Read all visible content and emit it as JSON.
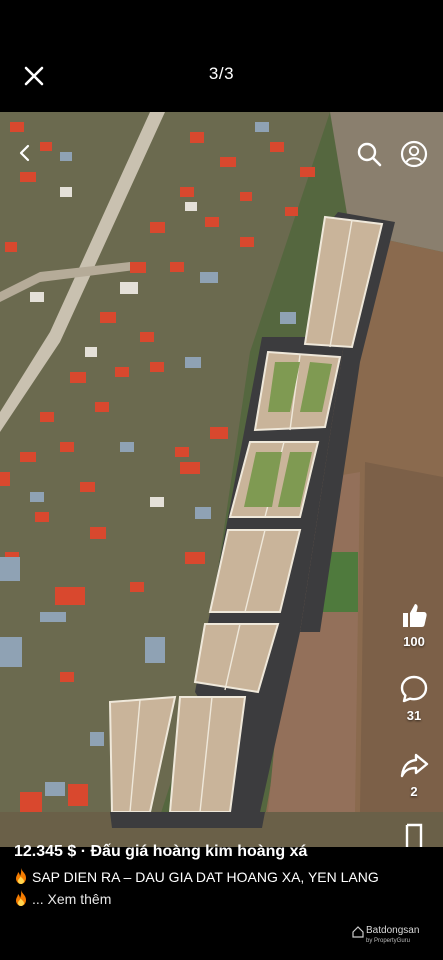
{
  "header": {
    "counter": "3/3"
  },
  "actions": {
    "like_count": "100",
    "comment_count": "31",
    "share_count": "2"
  },
  "post": {
    "title": "12.345 $ · Đấu giá hoàng kim hoàng xá",
    "line2": "SAP DIEN RA – DAU GIA DAT HOANG XA, YEN LANG",
    "line3": "... Xem thêm"
  },
  "watermark": {
    "brand": "Batdongsan",
    "sub": "by PropertyGuru"
  },
  "icons": {
    "close": "close-icon",
    "back": "back-arrow-icon",
    "search": "search-icon",
    "profile": "profile-icon",
    "like": "thumbs-up-icon",
    "comment": "comment-icon",
    "share": "share-icon",
    "bookmark": "bookmark-icon",
    "fire": "fire-icon"
  },
  "colors": {
    "background": "#000000",
    "text": "#ffffff",
    "roofs": "#d9482e",
    "field": "#8a6a4e"
  }
}
